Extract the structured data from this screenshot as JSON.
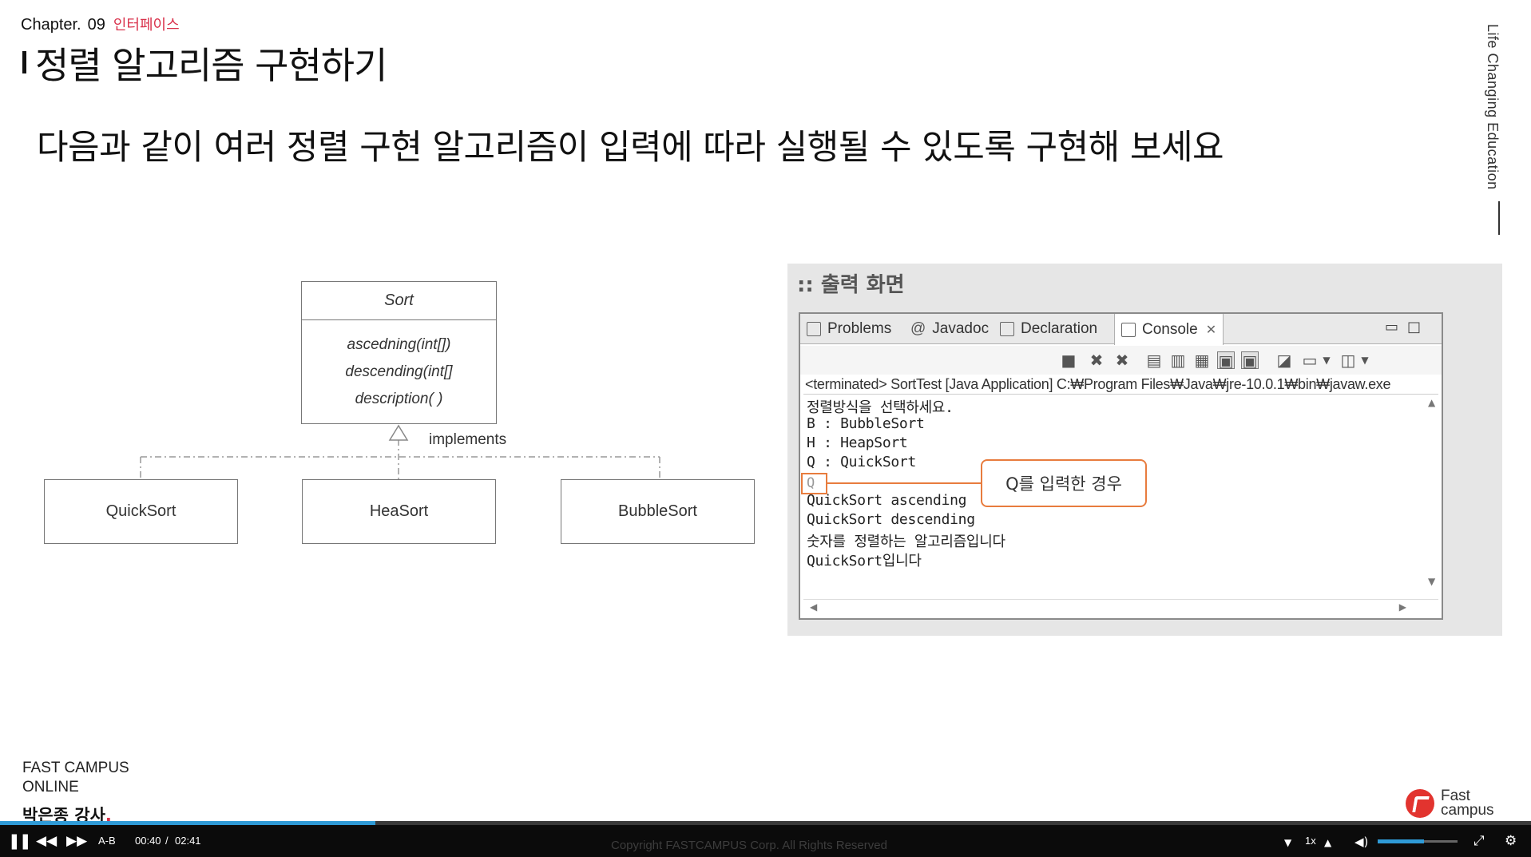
{
  "slide": {
    "chapter_label": "Chapter.",
    "chapter_num": "09",
    "chapter_tag": "인터페이스",
    "title": "정렬 알고리즘 구현하기",
    "subtitle": "다음과 같이 여러 정렬 구현 알고리즘이 입력에 따라 실행될 수 있도록 구현해 보세요",
    "side_text": "Life Changing Education"
  },
  "uml": {
    "parent": "Sort",
    "methods": [
      "ascedning(int[])",
      "descending(int[]",
      "description( )"
    ],
    "implements_label": "implements",
    "children": [
      "QuickSort",
      "HeaSort",
      "BubbleSort"
    ]
  },
  "output_panel": {
    "title": ":: 출력 화면",
    "tabs": [
      "Problems",
      "Javadoc",
      "Declaration",
      "Console"
    ],
    "tab_close": "✕",
    "terminated": "<terminated> SortTest [Java Application] C:₩Program Files₩Java₩jre-10.0.1₩bin₩javaw.exe",
    "lines": [
      "정렬방식을 선택하세요.",
      "B : BubbleSort",
      "H : HeapSort",
      "Q : QuickSort",
      "",
      "QuickSort ascending",
      "QuickSort descending",
      "숫자를 정렬하는 알고리즘입니다",
      "QuickSort입니다"
    ],
    "input_value": "Q",
    "callout": "Q를 입력한 경우"
  },
  "footer": {
    "brand_line1": "FAST CAMPUS",
    "brand_line2": "ONLINE",
    "lecturer": "박은종 강사",
    "lecturer_dot": ".",
    "logo_line1": "Fast",
    "logo_line2": "campus"
  },
  "player": {
    "ab_label": "A-B",
    "current_time": "00:40",
    "separator": "/",
    "duration": "02:41",
    "copyright": "Copyright  FASTCAMPUS  Corp.  All  Rights  Reserved",
    "speed": "1x",
    "progress_fraction": 0.245,
    "volume_fraction": 0.58,
    "accent_color": "#2f9ad6"
  }
}
